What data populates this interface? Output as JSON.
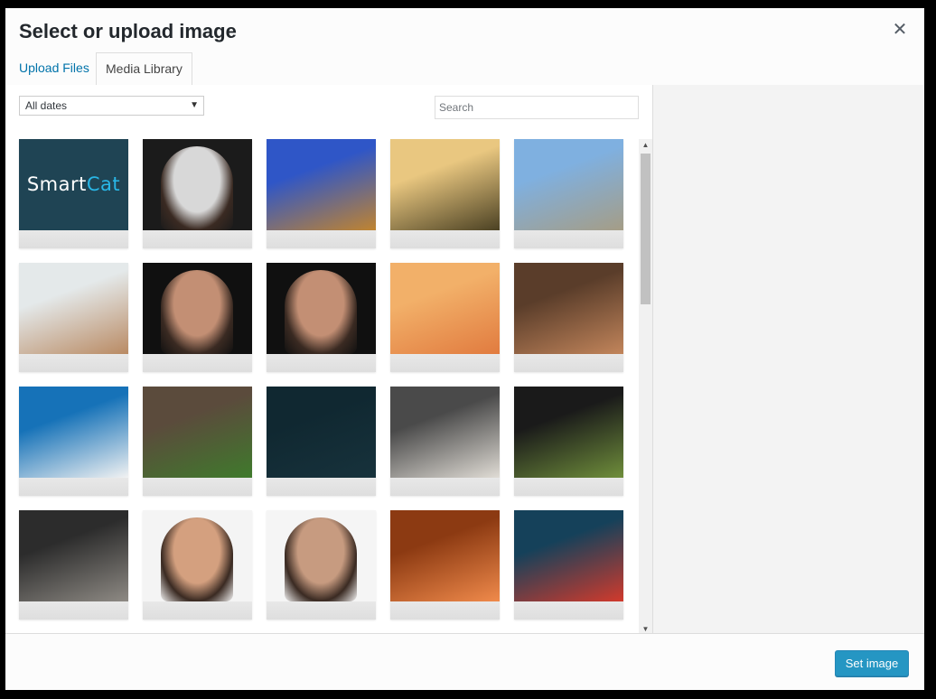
{
  "modal": {
    "title": "Select or upload image",
    "close_glyph": "✕"
  },
  "tabs": [
    {
      "label": "Upload Files",
      "active": false
    },
    {
      "label": "Media Library",
      "active": true
    }
  ],
  "filters": {
    "date_selected": "All dates",
    "search_placeholder": "Search"
  },
  "thumbnails": [
    {
      "subject": "smartcat-logo",
      "text": "SmartCat",
      "colors": [
        "#1f4454",
        "#29b7e7"
      ]
    },
    {
      "subject": "portfolio-webpage-woman",
      "colors": [
        "#1b1b1b",
        "#d8d8d8"
      ]
    },
    {
      "subject": "coastal-village-night",
      "colors": [
        "#2f56c7",
        "#c08430"
      ]
    },
    {
      "subject": "balloons-sunrise",
      "colors": [
        "#e9c780",
        "#4b4123"
      ]
    },
    {
      "subject": "waterfront-town",
      "colors": [
        "#7fb0e0",
        "#a59d86"
      ]
    },
    {
      "subject": "florence-skyline",
      "colors": [
        "#e4e9ea",
        "#b98a63"
      ]
    },
    {
      "subject": "man-with-glasses",
      "colors": [
        "#101010",
        "#c38f74"
      ]
    },
    {
      "subject": "man-with-glasses",
      "colors": [
        "#101010",
        "#c38f74"
      ]
    },
    {
      "subject": "desert-taxi-sunset",
      "colors": [
        "#f2b069",
        "#e17b3f"
      ]
    },
    {
      "subject": "city-aerial",
      "colors": [
        "#5a3d2a",
        "#c2855b"
      ]
    },
    {
      "subject": "santorini-sea",
      "colors": [
        "#1672b8",
        "#f2f2f2"
      ]
    },
    {
      "subject": "herbs-tomatoes-kitchen",
      "colors": [
        "#5b4b3c",
        "#3f7a2c"
      ]
    },
    {
      "subject": "dark-teal",
      "colors": [
        "#102831",
        "#17323c"
      ]
    },
    {
      "subject": "laptop-coffee-desk",
      "colors": [
        "#4a4a4a",
        "#e0dcd5"
      ]
    },
    {
      "subject": "food-splash-dark",
      "colors": [
        "#1a1a1a",
        "#6f8e3b"
      ]
    },
    {
      "subject": "street-shop",
      "colors": [
        "#2c2c2c",
        "#8e8a84"
      ]
    },
    {
      "subject": "businessman-thumbs-up",
      "colors": [
        "#f4f4f4",
        "#d4a07f"
      ]
    },
    {
      "subject": "smiling-man-portrait",
      "colors": [
        "#f5f5f5",
        "#c79b80"
      ]
    },
    {
      "subject": "sushi-chopsticks",
      "colors": [
        "#8c3a12",
        "#f08a4b"
      ]
    },
    {
      "subject": "red-bridge-night",
      "colors": [
        "#15415a",
        "#d23a2c"
      ]
    }
  ],
  "footer": {
    "set_image_label": "Set image",
    "accent": "#0085ba"
  }
}
